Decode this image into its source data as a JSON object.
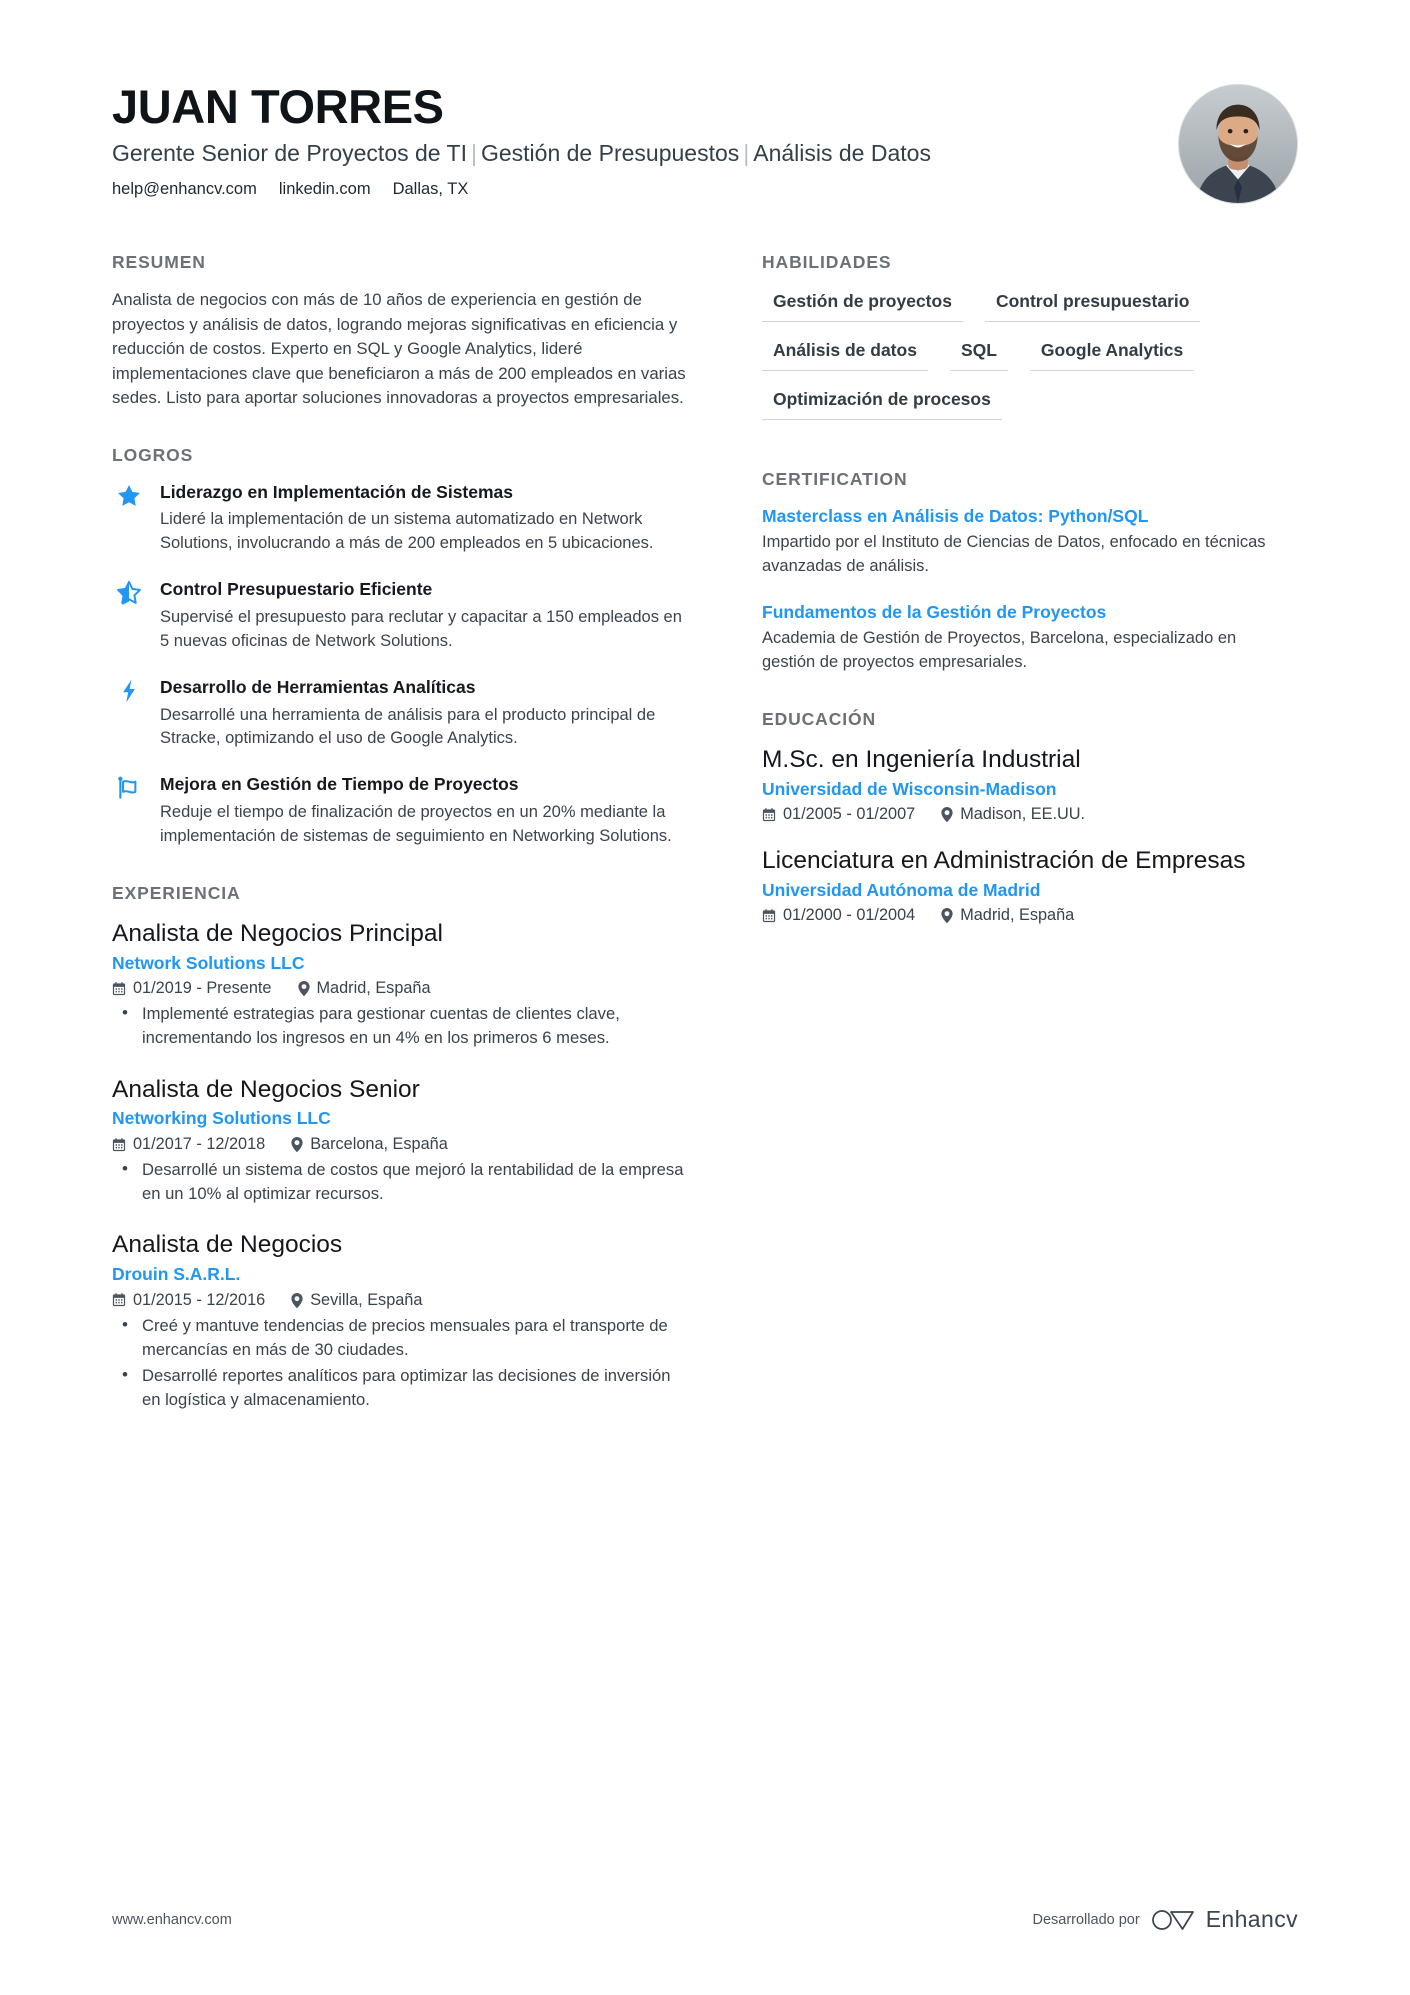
{
  "header": {
    "name": "JUAN TORRES",
    "headline_parts": [
      "Gerente Senior de Proyectos de TI",
      "Gestión de Presupuestos",
      "Análisis de Datos"
    ],
    "separator": "|",
    "contact": [
      {
        "icon": "email-icon",
        "text": "help@enhancv.com"
      },
      {
        "icon": "linkedin-icon",
        "text": "linkedin.com"
      },
      {
        "icon": "location-icon",
        "text": "Dallas, TX"
      }
    ],
    "avatar_alt": "profile-photo"
  },
  "left": {
    "summary": {
      "title": "RESUMEN",
      "text": "Analista de negocios con más de 10 años de experiencia en gestión de proyectos y análisis de datos, logrando mejoras significativas en eficiencia y reducción de costos. Experto en SQL y Google Analytics, lideré implementaciones clave que beneficiaron a más de 200 empleados en varias sedes. Listo para aportar soluciones innovadoras a proyectos empresariales."
    },
    "achievements": {
      "title": "LOGROS",
      "items": [
        {
          "icon": "star-filled-icon",
          "title": "Liderazgo en Implementación de Sistemas",
          "desc": "Lideré la implementación de un sistema automatizado en Network Solutions, involucrando a más de 200 empleados en 5 ubicaciones."
        },
        {
          "icon": "star-half-icon",
          "title": "Control Presupuestario Eficiente",
          "desc": "Supervisé el presupuesto para reclutar y capacitar a 150 empleados en 5 nuevas oficinas de Network Solutions."
        },
        {
          "icon": "lightning-bolt-icon",
          "title": "Desarrollo de Herramientas Analíticas",
          "desc": "Desarrollé una herramienta de análisis para el producto principal de Stracke, optimizando el uso de Google Analytics."
        },
        {
          "icon": "flag-icon",
          "title": "Mejora en Gestión de Tiempo de Proyectos",
          "desc": "Reduje el tiempo de finalización de proyectos en un 20% mediante la implementación de sistemas de seguimiento en Networking Solutions."
        }
      ]
    },
    "experience": {
      "title": "EXPERIENCIA",
      "jobs": [
        {
          "role": "Analista de Negocios Principal",
          "company": "Network Solutions LLC",
          "dates": "01/2019 - Presente",
          "location": "Madrid, España",
          "bullets": [
            "Implementé estrategias para gestionar cuentas de clientes clave, incrementando los ingresos en un 4% en los primeros 6 meses."
          ]
        },
        {
          "role": "Analista de Negocios Senior",
          "company": "Networking Solutions LLC",
          "dates": "01/2017 - 12/2018",
          "location": "Barcelona, España",
          "bullets": [
            "Desarrollé un sistema de costos que mejoró la rentabilidad de la empresa en un 10% al optimizar recursos."
          ]
        },
        {
          "role": "Analista de Negocios",
          "company": "Drouin S.A.R.L.",
          "dates": "01/2015 - 12/2016",
          "location": "Sevilla, España",
          "bullets": [
            "Creé y mantuve tendencias de precios mensuales para el transporte de mercancías en más de 30 ciudades.",
            "Desarrollé reportes analíticos para optimizar las decisiones de inversión en logística y almacenamiento."
          ]
        }
      ]
    }
  },
  "right": {
    "skills": {
      "title": "HABILIDADES",
      "items": [
        "Gestión de proyectos",
        "Control presupuestario",
        "Análisis de datos",
        "SQL",
        "Google Analytics",
        "Optimización de procesos"
      ]
    },
    "certification": {
      "title": "CERTIFICATION",
      "items": [
        {
          "name": "Masterclass en Análisis de Datos: Python/SQL",
          "desc": "Impartido por el Instituto de Ciencias de Datos, enfocado en técnicas avanzadas de análisis."
        },
        {
          "name": "Fundamentos de la Gestión de Proyectos",
          "desc": "Academia de Gestión de Proyectos, Barcelona, especializado en gestión de proyectos empresariales."
        }
      ]
    },
    "education": {
      "title": "EDUCACIÓN",
      "items": [
        {
          "degree": "M.Sc. en Ingeniería Industrial",
          "school": "Universidad de Wisconsin-Madison",
          "dates": "01/2005 - 01/2007",
          "location": "Madison, EE.UU."
        },
        {
          "degree": "Licenciatura en Administración de Empresas",
          "school": "Universidad Autónoma de Madrid",
          "dates": "01/2000 - 01/2004",
          "location": "Madrid, España"
        }
      ]
    }
  },
  "footer": {
    "website": "www.enhancv.com",
    "powered_by": "Desarrollado por",
    "brand": "Enhancv"
  },
  "colors": {
    "accent": "#2196f3",
    "heading": "#6b7177",
    "body": "#39434c",
    "title": "#14181c"
  }
}
